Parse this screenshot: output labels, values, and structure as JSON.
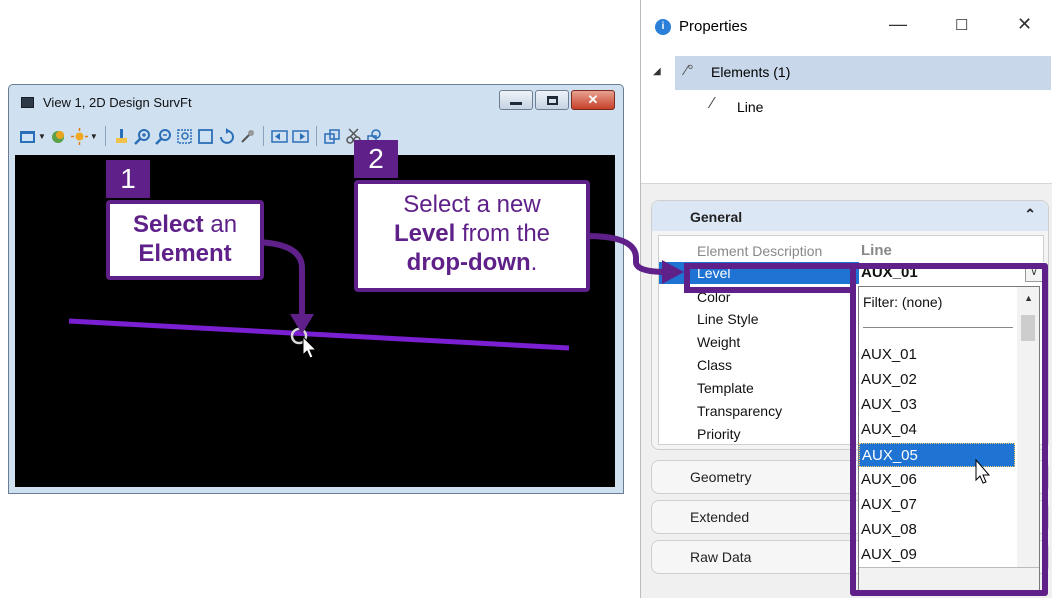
{
  "view_window": {
    "title": "View 1, 2D Design SurvFt"
  },
  "callouts": {
    "step1": {
      "number": "1",
      "bold1": "Select",
      "text1": " an",
      "bold2": "Element"
    },
    "step2": {
      "number": "2",
      "line1": "Select a new",
      "bold1": "Level",
      "line2b": " from the",
      "bold2": "drop-down",
      "line3b": "."
    }
  },
  "properties": {
    "title": "Properties",
    "tree": {
      "root": "Elements (1)",
      "child": "Line"
    },
    "sections": {
      "general": "General",
      "geometry": "Geometry",
      "extended": "Extended",
      "raw_data": "Raw Data"
    },
    "rows": [
      {
        "name": "Element Description",
        "value": "Line"
      },
      {
        "name": "Level",
        "value": "AUX_01"
      },
      {
        "name": "Color",
        "value": ""
      },
      {
        "name": "Line Style",
        "value": ""
      },
      {
        "name": "Weight",
        "value": ""
      },
      {
        "name": "Class",
        "value": ""
      },
      {
        "name": "Template",
        "value": ""
      },
      {
        "name": "Transparency",
        "value": ""
      },
      {
        "name": "Priority",
        "value": ""
      }
    ],
    "dropdown": {
      "filter": "Filter: (none)",
      "items": [
        "AUX_01",
        "AUX_02",
        "AUX_03",
        "AUX_04",
        "AUX_05",
        "AUX_06",
        "AUX_07",
        "AUX_08",
        "AUX_09"
      ],
      "selected": "AUX_05"
    }
  },
  "colors": {
    "accent_purple": "#5f2189",
    "selection_blue": "#1e73d3"
  }
}
